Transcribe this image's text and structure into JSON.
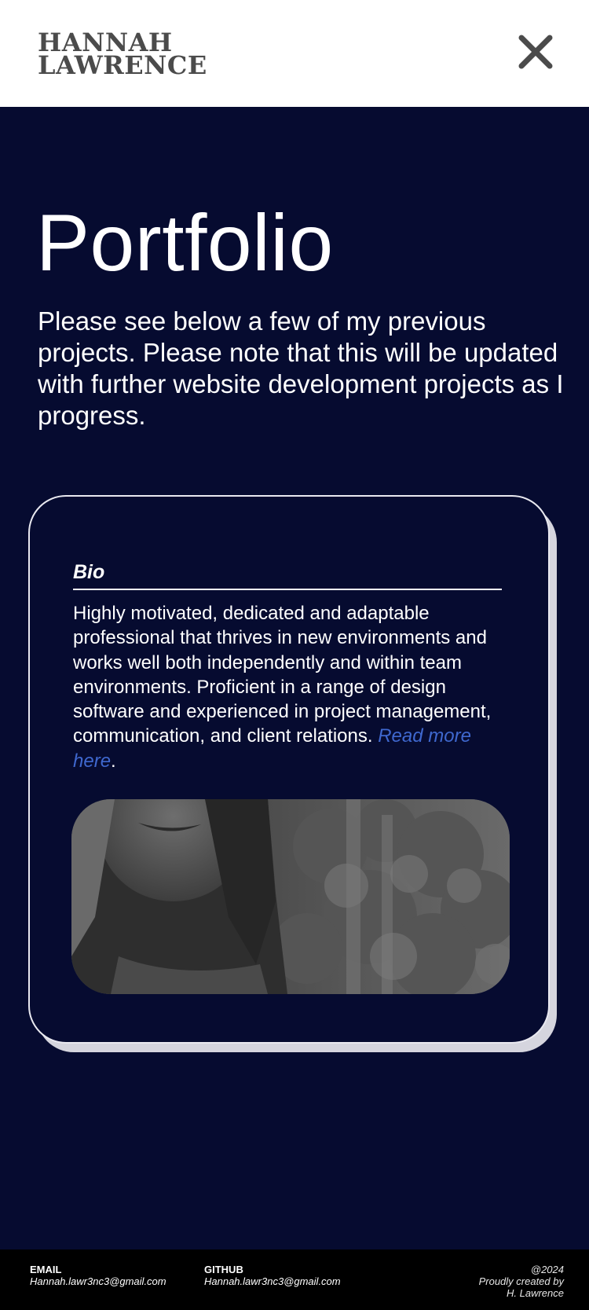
{
  "header": {
    "logo_line1": "HANNAH",
    "logo_line2": "LAWRENCE",
    "close_icon": "close-icon"
  },
  "main": {
    "title": "Portfolio",
    "intro": "Please see below a few of my previous projects. Please note that this will be updated with further website development projects as I progress."
  },
  "card": {
    "heading": "Bio",
    "text": "Highly motivated, dedicated and adaptable professional that thrives in new environments and works well both independently and within team environments. Proficient in a range of design software and experienced in project management, communication, and client relations.",
    "link_text": "Read more here",
    "link_suffix": "."
  },
  "footer": {
    "email_label": "EMAIL",
    "email_value": "Hannah.lawr3nc3@gmail.com",
    "github_label": "GITHUB",
    "github_value": "Hannah.lawr3nc3@gmail.com",
    "copyright": "@2024",
    "credit_line1": "Proudly created by",
    "credit_line2": "H. Lawrence"
  },
  "colors": {
    "background": "#060b30",
    "header_bg": "#ffffff",
    "logo": "#4b4b4b",
    "link": "#3f68cf",
    "footer_bg": "#000000"
  }
}
